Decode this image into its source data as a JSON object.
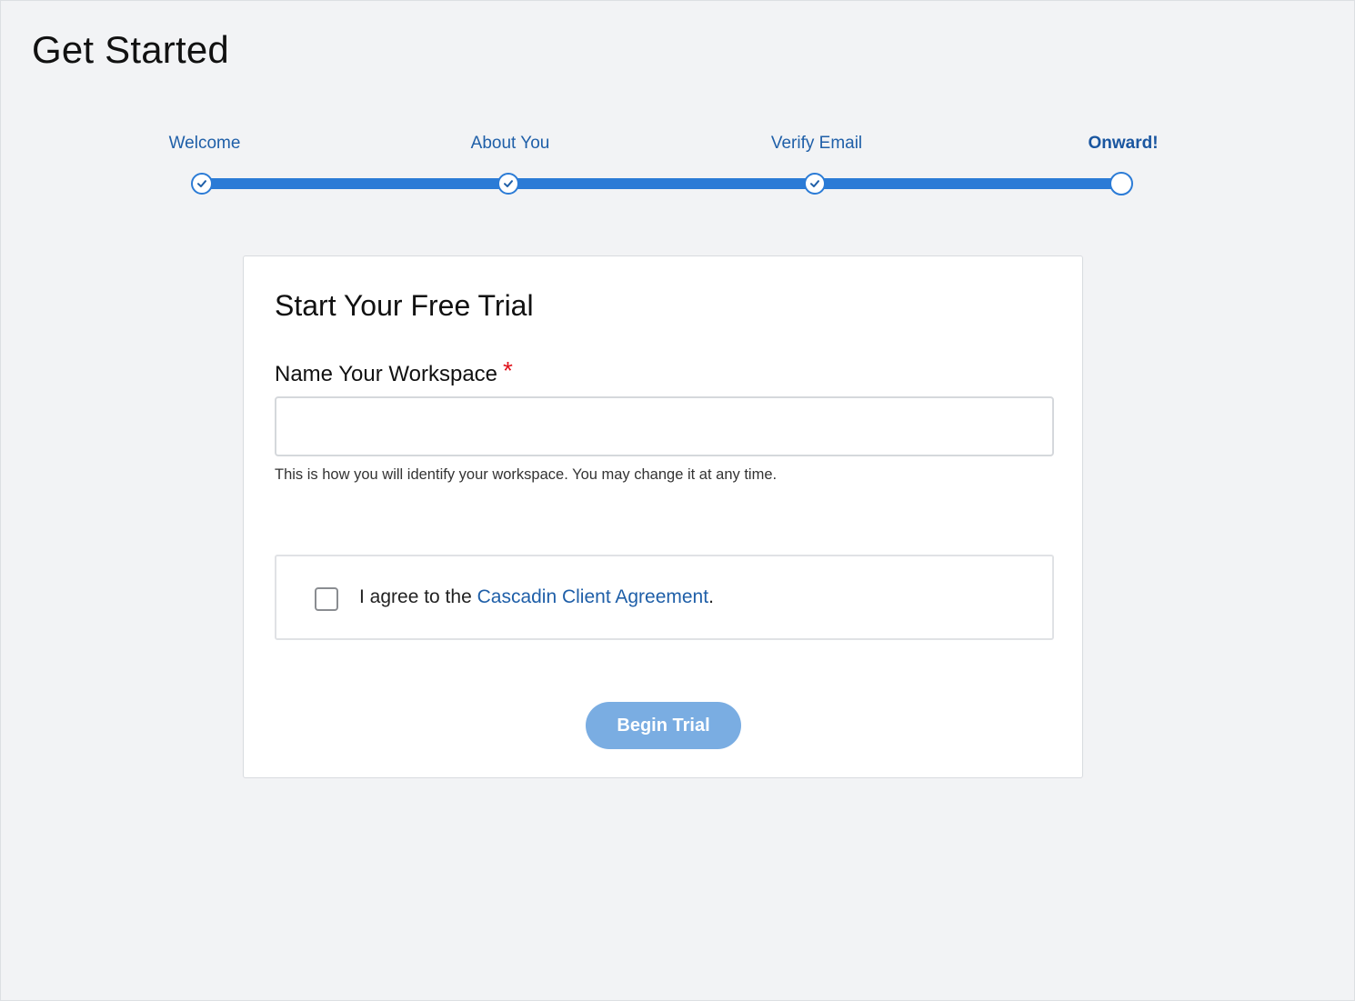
{
  "page": {
    "title": "Get Started"
  },
  "stepper": {
    "steps": [
      {
        "label": "Welcome",
        "completed": true
      },
      {
        "label": "About You",
        "completed": true
      },
      {
        "label": "Verify Email",
        "completed": true
      },
      {
        "label": "Onward!",
        "completed": false,
        "current": true
      }
    ],
    "accent_color": "#2b7bd6"
  },
  "card": {
    "title": "Start Your Free Trial",
    "workspace_field": {
      "label": "Name Your Workspace",
      "required_mark": "*",
      "value": "",
      "placeholder": "",
      "helper": "This is how you will identify your workspace. You may change it at any time."
    },
    "agreement": {
      "checked": false,
      "prefix": "I agree to the ",
      "link_text": "Cascadin Client Agreement",
      "suffix": "."
    },
    "submit_label": "Begin Trial"
  },
  "colors": {
    "background": "#f2f3f5",
    "link": "#1f5fa8",
    "required": "#e0121b",
    "button_disabled": "#7aade2"
  }
}
